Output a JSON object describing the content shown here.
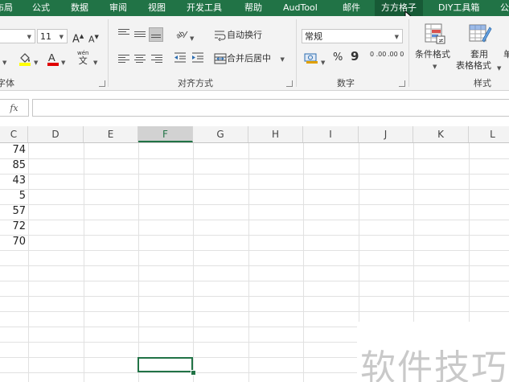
{
  "tabs": [
    "布局",
    "公式",
    "数据",
    "审阅",
    "视图",
    "开发工具",
    "帮助",
    "AudTool",
    "邮件",
    "方方格子",
    "DIY工具箱",
    "公"
  ],
  "active_tab": "方方格子",
  "font_group": {
    "size_value": "11",
    "grow_font": "A",
    "shrink_font": "A",
    "label": "字体",
    "wen_glyph": "wén",
    "wen_char": "文"
  },
  "align_group": {
    "wrap_text": "自动换行",
    "merge_center": "合并后居中",
    "label": "对齐方式"
  },
  "number_group": {
    "format_value": "常规",
    "percent": "%",
    "comma": "9",
    "increase_decimal": "0 .00",
    "decrease_decimal": ".00 0",
    "label": "数字"
  },
  "styles_group": {
    "conditional_format": "条件格式",
    "format_table_line1": "套用",
    "format_table_line2": "表格格式",
    "cell_styles_partial": "单",
    "label": "样式"
  },
  "formula_bar": {
    "fx": "fx"
  },
  "columns": [
    "C",
    "D",
    "E",
    "F",
    "G",
    "H",
    "I",
    "J",
    "K",
    "L"
  ],
  "selected_column": "F",
  "column_c_values": [
    "74",
    "85",
    "43",
    "5",
    "57",
    "72",
    "70"
  ],
  "watermark": "软件技巧",
  "colors": {
    "excel_green": "#217346",
    "ribbon_bg": "#f3f3f3",
    "grid_line": "#e1e1e1"
  }
}
